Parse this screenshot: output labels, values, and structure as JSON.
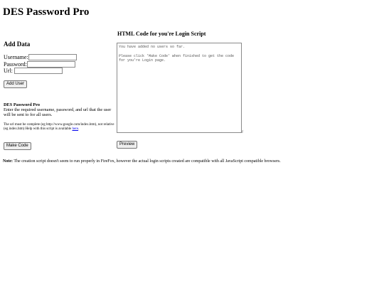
{
  "page": {
    "title": "DES Password Pro"
  },
  "add_data": {
    "heading": "Add Data",
    "username_label": "Username:",
    "password_label": "Password:",
    "url_label": "Url:",
    "username_value": "",
    "password_value": "",
    "url_value": "",
    "add_user_label": "Add User"
  },
  "info": {
    "title": "DES Password Pro",
    "text": "Enter the required username, password, and url that the user will be sent to for all users.",
    "note_text": "The url must be complete (eg http://www.google.com/index.htm), not relative (eg index.htm) Help with this script is available ",
    "note_link": "here",
    "note_end": ".",
    "make_code_label": "Make Code"
  },
  "code_panel": {
    "heading": "HTML Code for you're Login Script",
    "content": "You have added no users so far.\n\nPlease click 'Make Code' when finished to get the code for you're Login page.",
    "preview_label": "Preview"
  },
  "footer": {
    "note_label": "Note:",
    "note_text": " The creation script doesn't seem to run properly in FireFox, however the actual login scripts created are compatible with all JavaScript compatible browsers."
  }
}
